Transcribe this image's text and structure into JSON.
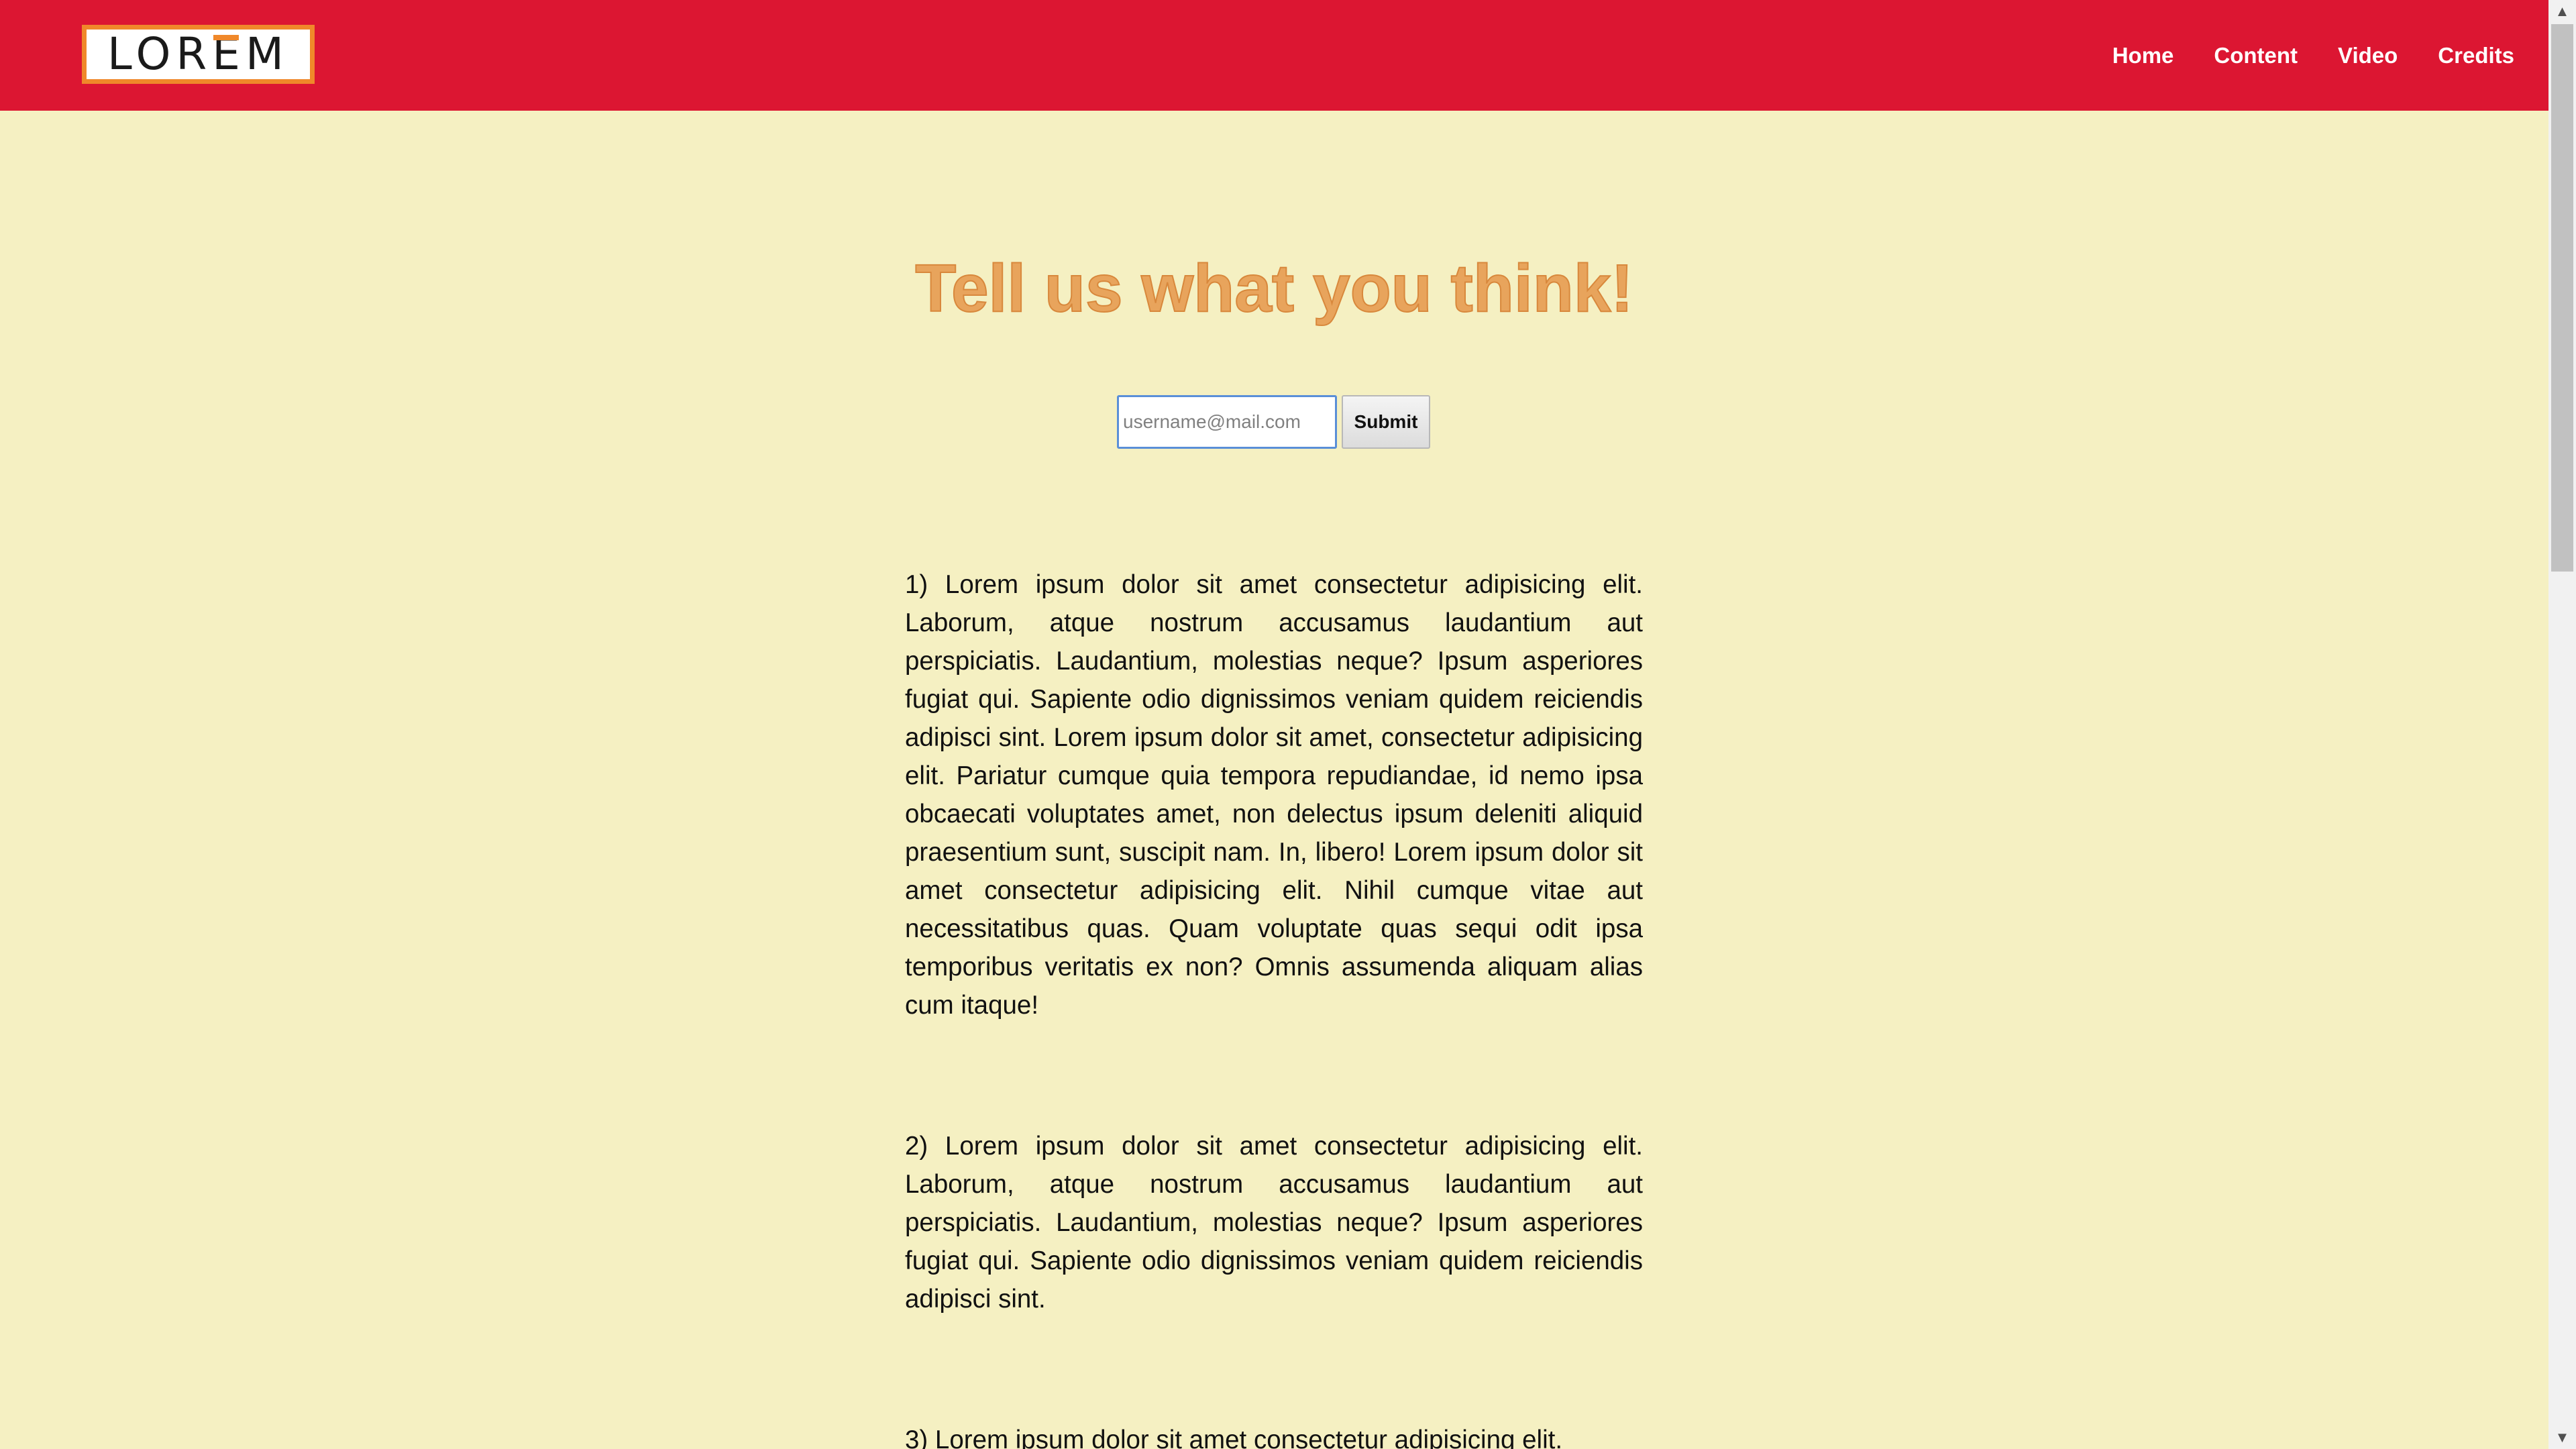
{
  "header": {
    "logo_text": "LOREM",
    "nav": [
      "Home",
      "Content",
      "Video",
      "Credits"
    ]
  },
  "main": {
    "title": "Tell us what you think!",
    "email_placeholder": "username@mail.com",
    "submit_label": "Submit",
    "paragraphs": [
      "1) Lorem ipsum dolor sit amet consectetur adipisicing elit. Laborum, atque nostrum accusamus laudantium aut perspiciatis. Laudantium, molestias neque? Ipsum asperiores fugiat qui. Sapiente odio dignissimos veniam quidem reiciendis adipisci sint. Lorem ipsum dolor sit amet, consectetur adipisicing elit. Pariatur cumque quia tempora repudiandae, id nemo ipsa obcaecati voluptates amet, non delectus ipsum deleniti aliquid praesentium sunt, suscipit nam. In, libero! Lorem ipsum dolor sit amet consectetur adipisicing elit. Nihil cumque vitae aut necessitatibus quas. Quam voluptate quas sequi odit ipsa temporibus veritatis ex non? Omnis assumenda aliquam alias cum itaque!",
      "2) Lorem ipsum dolor sit amet consectetur adipisicing elit. Laborum, atque nostrum accusamus laudantium aut perspiciatis. Laudantium, molestias neque? Ipsum asperiores fugiat qui. Sapiente odio dignissimos veniam quidem reiciendis adipisci sint.",
      "3) Lorem ipsum dolor sit amet consectetur adipisicing elit."
    ]
  },
  "colors": {
    "header_bg": "#dc1632",
    "page_bg": "#f5f0c2",
    "accent_orange": "#f0882a",
    "title_color": "#e8a45c"
  }
}
